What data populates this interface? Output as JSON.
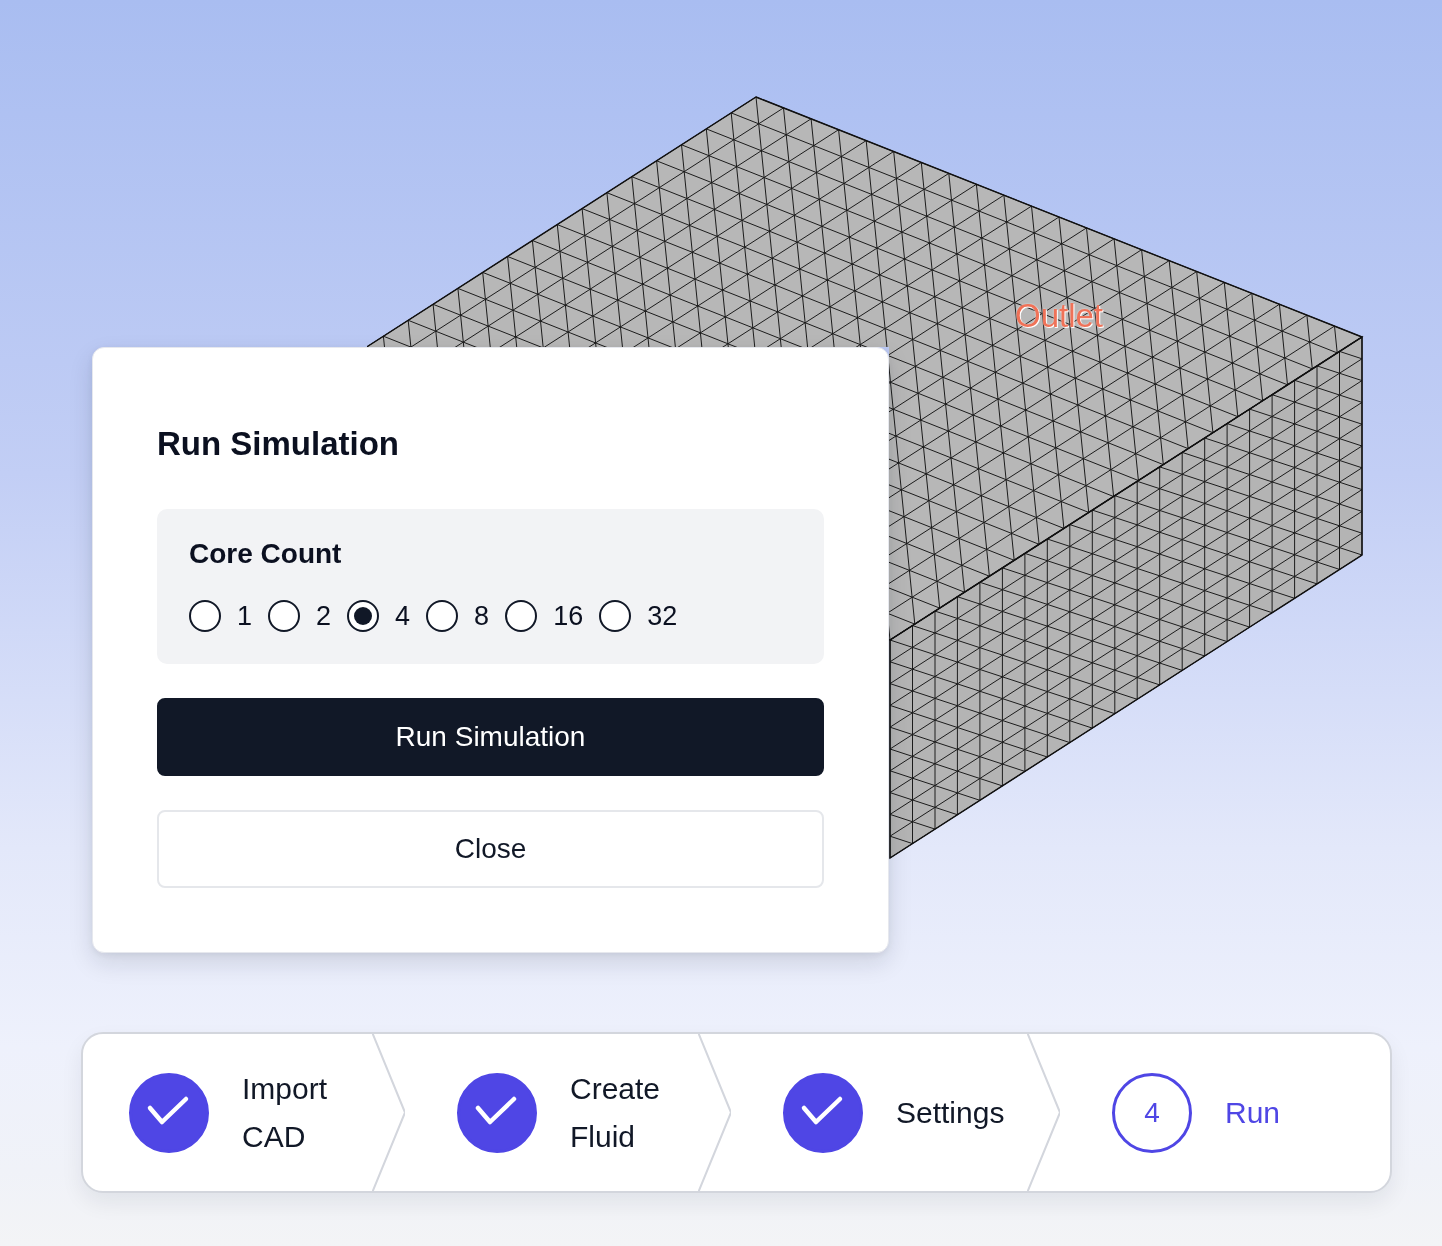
{
  "viewport": {
    "labels": [
      {
        "text": "Outlet"
      }
    ]
  },
  "dialog": {
    "title": "Run Simulation",
    "core_count": {
      "label": "Core Count",
      "options": [
        {
          "label": "1",
          "selected": false
        },
        {
          "label": "2",
          "selected": false
        },
        {
          "label": "4",
          "selected": true
        },
        {
          "label": "8",
          "selected": false
        },
        {
          "label": "16",
          "selected": false
        },
        {
          "label": "32",
          "selected": false
        }
      ]
    },
    "buttons": [
      {
        "label": "Run Simulation",
        "kind": "primary"
      },
      {
        "label": "Close",
        "kind": "secondary"
      }
    ]
  },
  "stepper": {
    "steps": [
      {
        "label": "Import CAD",
        "completed": true,
        "selected": false
      },
      {
        "label": "Create Fluid",
        "completed": true,
        "selected": false
      },
      {
        "label": "Settings",
        "completed": true,
        "selected": false
      },
      {
        "label": "Run",
        "number": "4",
        "completed": false,
        "selected": true
      }
    ]
  }
}
